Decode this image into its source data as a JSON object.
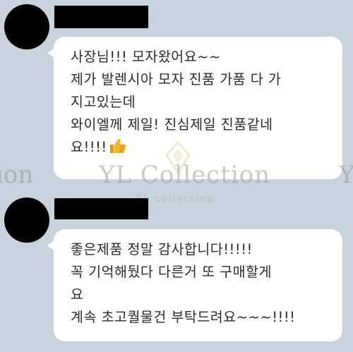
{
  "chat": {
    "messages": [
      {
        "sender_name": "",
        "lines": [
          "사장님!!! 모자왔어요~~",
          "제가 발렌시아 모자 진품 가품 다 가",
          "지고있는데",
          "와이엘께 제일! 진심제일 진품같네",
          "요!!!!"
        ],
        "emoji": "thumbs-up-icon"
      },
      {
        "sender_name": "",
        "lines": [
          "좋은제품 정말 감사합니다!!!!!",
          "꼭 기억해뒀다 다른거 또 구매할게",
          "요",
          "계속 초고퀄물건 부탁드려요~~~!!!!"
        ]
      }
    ]
  },
  "watermark": {
    "main": "YL Collection",
    "sub": "YL collection",
    "edge_left": "ion",
    "edge_right": "Y"
  },
  "colors": {
    "background": "#c9d3dd",
    "bubble": "#ffffff",
    "text": "#2a2a2a",
    "redaction": "#000000",
    "thumb": "#f2b32a"
  }
}
